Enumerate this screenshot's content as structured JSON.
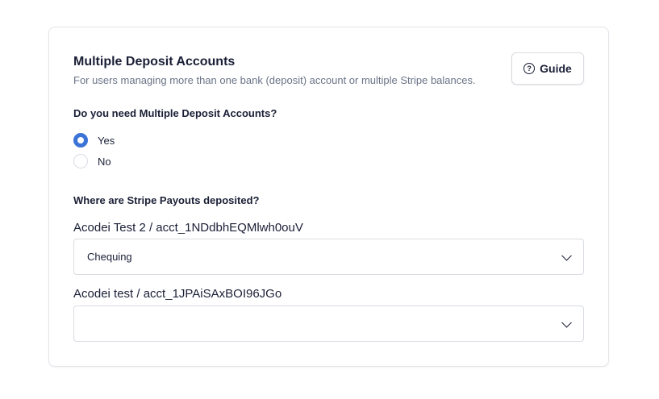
{
  "section": {
    "title": "Multiple Deposit Accounts",
    "subtitle": "For users managing more than one bank (deposit) account or multiple Stripe balances.",
    "guide_button": {
      "label": "Guide",
      "icon": "help-circle-icon"
    }
  },
  "multiple_accounts": {
    "question": "Do you need Multiple Deposit Accounts?",
    "options": [
      {
        "label": "Yes",
        "selected": true
      },
      {
        "label": "No",
        "selected": false
      }
    ]
  },
  "payouts": {
    "question": "Where are Stripe Payouts deposited?",
    "accounts": [
      {
        "label": "Acodei Test 2 / acct_1NDdbhEQMlwh0ouV",
        "selected_value": "Chequing"
      },
      {
        "label": "Acodei test / acct_1JPAiSAxBOI96JGo",
        "selected_value": ""
      }
    ]
  },
  "colors": {
    "accent": "#3b73d6",
    "border": "#d9dce2",
    "muted_text": "#697386"
  }
}
